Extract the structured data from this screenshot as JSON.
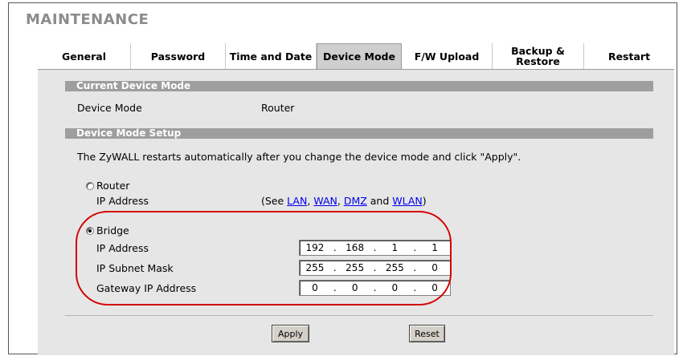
{
  "page": {
    "title": "MAINTENANCE"
  },
  "tabs": [
    {
      "label": "General"
    },
    {
      "label": "Password"
    },
    {
      "label": "Time and Date"
    },
    {
      "label": "Device Mode",
      "active": true
    },
    {
      "label": "F/W Upload"
    },
    {
      "label": "Backup & Restore"
    },
    {
      "label": "Restart"
    }
  ],
  "current": {
    "header": "Current Device Mode",
    "label": "Device Mode",
    "value": "Router"
  },
  "setup": {
    "header": "Device Mode Setup",
    "note": "The ZyWALL restarts automatically after you change the device mode and click \"Apply\".",
    "router": {
      "label": "Router",
      "selected": false,
      "ip_label": "IP Address",
      "see_prefix": "(See ",
      "link_lan": "LAN",
      "sep1": ", ",
      "link_wan": "WAN",
      "sep2": ", ",
      "link_dmz": "DMZ",
      "and": " and ",
      "link_wlan": "WLAN",
      "see_suffix": ")"
    },
    "bridge": {
      "label": "Bridge",
      "selected": true,
      "ip_label": "IP Address",
      "ip": [
        "192",
        "168",
        "1",
        "1"
      ],
      "mask_label": "IP Subnet Mask",
      "mask": [
        "255",
        "255",
        "255",
        "0"
      ],
      "gw_label": "Gateway IP Address",
      "gw": [
        "0",
        "0",
        "0",
        "0"
      ]
    }
  },
  "buttons": {
    "apply": "Apply",
    "reset": "Reset"
  },
  "colors": {
    "highlight": "#d40000",
    "section_bar": "#9e9e9e",
    "panel": "#e6e6e6",
    "link": "#0000ee"
  }
}
